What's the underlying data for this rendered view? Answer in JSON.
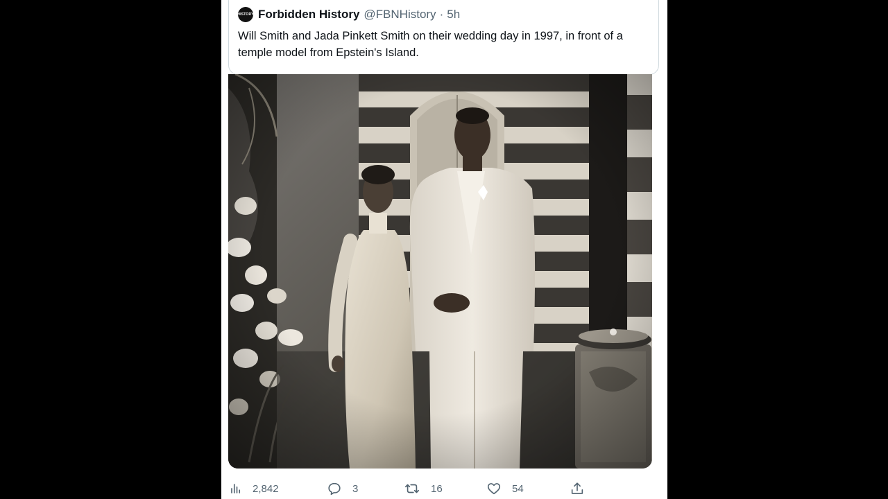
{
  "tweet": {
    "display_name": "Forbidden History",
    "handle": "@FBNHistory",
    "separator": "·",
    "time": "5h",
    "avatar_text": "HISTORY",
    "text": "Will Smith and Jada Pinkett Smith on their wedding day in 1997, in front of a temple model from Epstein's Island."
  },
  "actions": {
    "views": "2,842",
    "replies": "3",
    "retweets": "16",
    "likes": "54"
  },
  "icons": {
    "views": "bar-chart-icon",
    "replies": "comment-bubble-icon",
    "retweets": "retweet-icon",
    "likes": "heart-icon",
    "share": "share-upload-icon"
  },
  "colors": {
    "background": "#000000",
    "panel": "#ffffff",
    "text": "#0f1419",
    "muted": "#536471",
    "border": "#cfd9de"
  }
}
